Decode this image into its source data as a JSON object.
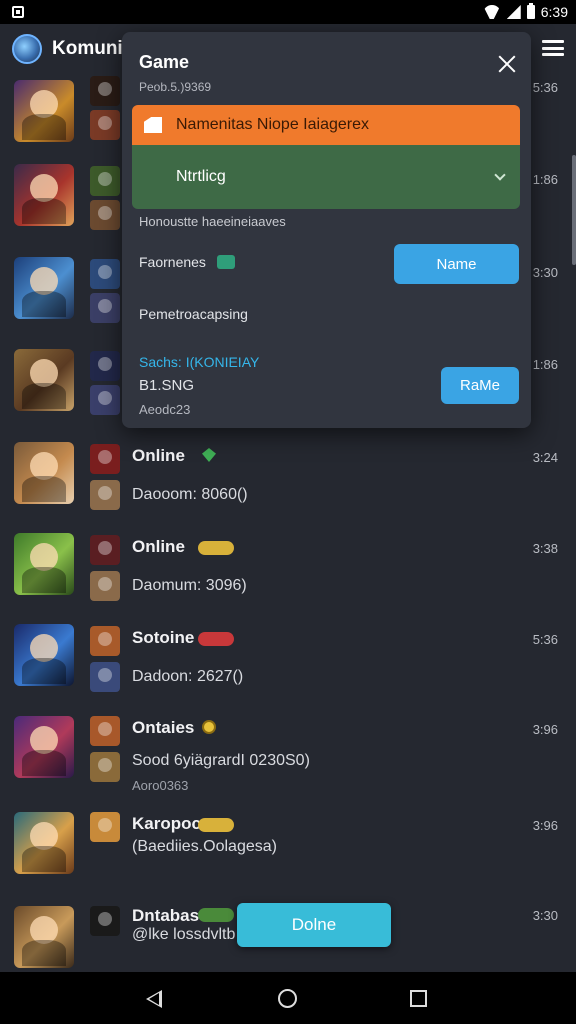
{
  "status": {
    "time": "6:39"
  },
  "appbar": {
    "title": "Komunit"
  },
  "dialog": {
    "title": "Game",
    "subtitle": "Peob.5.)9369",
    "banner_orange": "Namenitas Niope Iaiagerex",
    "banner_green": "Ntrtlicg",
    "line1": "Honoustte haeeineiaaves",
    "row1_label": "Faornenes",
    "row1_button": "Name",
    "line2": "Pemetroacapsing",
    "cyan_line": "Sachs: I(KONIEIAY",
    "amount": "B1.SNG",
    "code": "Aeodc23",
    "row2_button": "RaMe"
  },
  "list": [
    {
      "name": "",
      "sub": "",
      "sub2": "",
      "time": "5:36"
    },
    {
      "name": "",
      "sub": "",
      "sub2": "",
      "time": "1:86"
    },
    {
      "name": "",
      "sub": "",
      "sub2": "",
      "time": "3:30"
    },
    {
      "name": "",
      "sub": "",
      "sub2": "",
      "time": "1:86"
    },
    {
      "name": "Online",
      "sub": "Daooom: 8060()",
      "sub2": "",
      "time": "3:24"
    },
    {
      "name": "Online",
      "sub": "Daomum: 3096)",
      "sub2": "",
      "time": "3:38"
    },
    {
      "name": "Sotoine",
      "sub": "Dadoon: 2627()",
      "sub2": "",
      "time": "5:36"
    },
    {
      "name": "Ontaies",
      "sub": "Sood 6yiägrardI 0230S0)",
      "sub2": "Aoro0363",
      "time": "3:96"
    },
    {
      "name": "Karopoc",
      "sub": "(Baediies.Oolagesa)",
      "sub2": "",
      "time": "3:96"
    },
    {
      "name": "Dntabas",
      "sub": "@lke lossdvltb",
      "sub2": "",
      "time": "3:30"
    }
  ],
  "float_button": "Dolne",
  "colors": {
    "accent": "#3aa4e4",
    "orange": "#f07a2c",
    "green": "#3e6a46",
    "background": "#252830"
  }
}
